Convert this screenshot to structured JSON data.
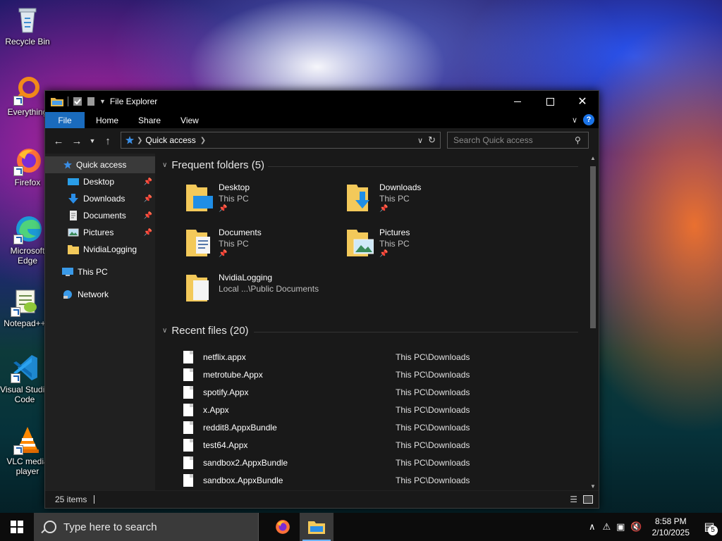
{
  "desktop": {
    "icons": [
      {
        "label": "Recycle Bin",
        "icon": "recycle-bin-icon"
      },
      {
        "label": "Everything",
        "icon": "everything-icon"
      },
      {
        "label": "Firefox",
        "icon": "firefox-icon"
      },
      {
        "label": "Microsoft Edge",
        "icon": "edge-icon"
      },
      {
        "label": "Notepad++",
        "icon": "notepadpp-icon"
      },
      {
        "label": "Visual Studio Code",
        "icon": "vscode-icon"
      },
      {
        "label": "VLC media player",
        "icon": "vlc-icon"
      }
    ]
  },
  "explorer": {
    "title": "File Explorer",
    "ribbon_tabs": [
      "File",
      "Home",
      "Share",
      "View"
    ],
    "address": {
      "crumb": "Quick access"
    },
    "search": {
      "placeholder": "Search Quick access"
    },
    "sidebar": {
      "items": [
        {
          "label": "Quick access",
          "icon": "star-icon",
          "pinned": false
        },
        {
          "label": "Desktop",
          "icon": "desktop-folder-icon",
          "pinned": true
        },
        {
          "label": "Downloads",
          "icon": "download-arrow-icon",
          "pinned": true
        },
        {
          "label": "Documents",
          "icon": "documents-folder-icon",
          "pinned": true
        },
        {
          "label": "Pictures",
          "icon": "pictures-folder-icon",
          "pinned": true
        },
        {
          "label": "NvidiaLogging",
          "icon": "folder-icon",
          "pinned": false
        },
        {
          "label": "This PC",
          "icon": "computer-icon",
          "pinned": false
        },
        {
          "label": "Network",
          "icon": "network-icon",
          "pinned": false
        }
      ]
    },
    "frequent": {
      "heading": "Frequent folders (5)",
      "folders": [
        {
          "name": "Desktop",
          "location": "This PC",
          "pinned": true
        },
        {
          "name": "Downloads",
          "location": "This PC",
          "pinned": true
        },
        {
          "name": "Documents",
          "location": "This PC",
          "pinned": true
        },
        {
          "name": "Pictures",
          "location": "This PC",
          "pinned": true
        },
        {
          "name": "NvidiaLogging",
          "location": "Local ...\\Public Documents",
          "pinned": false
        }
      ]
    },
    "recent": {
      "heading": "Recent files (20)",
      "files": [
        {
          "name": "netflix.appx",
          "location": "This PC\\Downloads"
        },
        {
          "name": "metrotube.Appx",
          "location": "This PC\\Downloads"
        },
        {
          "name": "spotify.Appx",
          "location": "This PC\\Downloads"
        },
        {
          "name": "x.Appx",
          "location": "This PC\\Downloads"
        },
        {
          "name": "reddit8.AppxBundle",
          "location": "This PC\\Downloads"
        },
        {
          "name": "test64.Appx",
          "location": "This PC\\Downloads"
        },
        {
          "name": "sandbox2.AppxBundle",
          "location": "This PC\\Downloads"
        },
        {
          "name": "sandbox.AppxBundle",
          "location": "This PC\\Downloads"
        }
      ]
    },
    "status": {
      "item_count": "25 items"
    }
  },
  "taskbar": {
    "search_placeholder": "Type here to search",
    "time": "8:58 PM",
    "date": "2/10/2025",
    "notification_count": "5"
  }
}
